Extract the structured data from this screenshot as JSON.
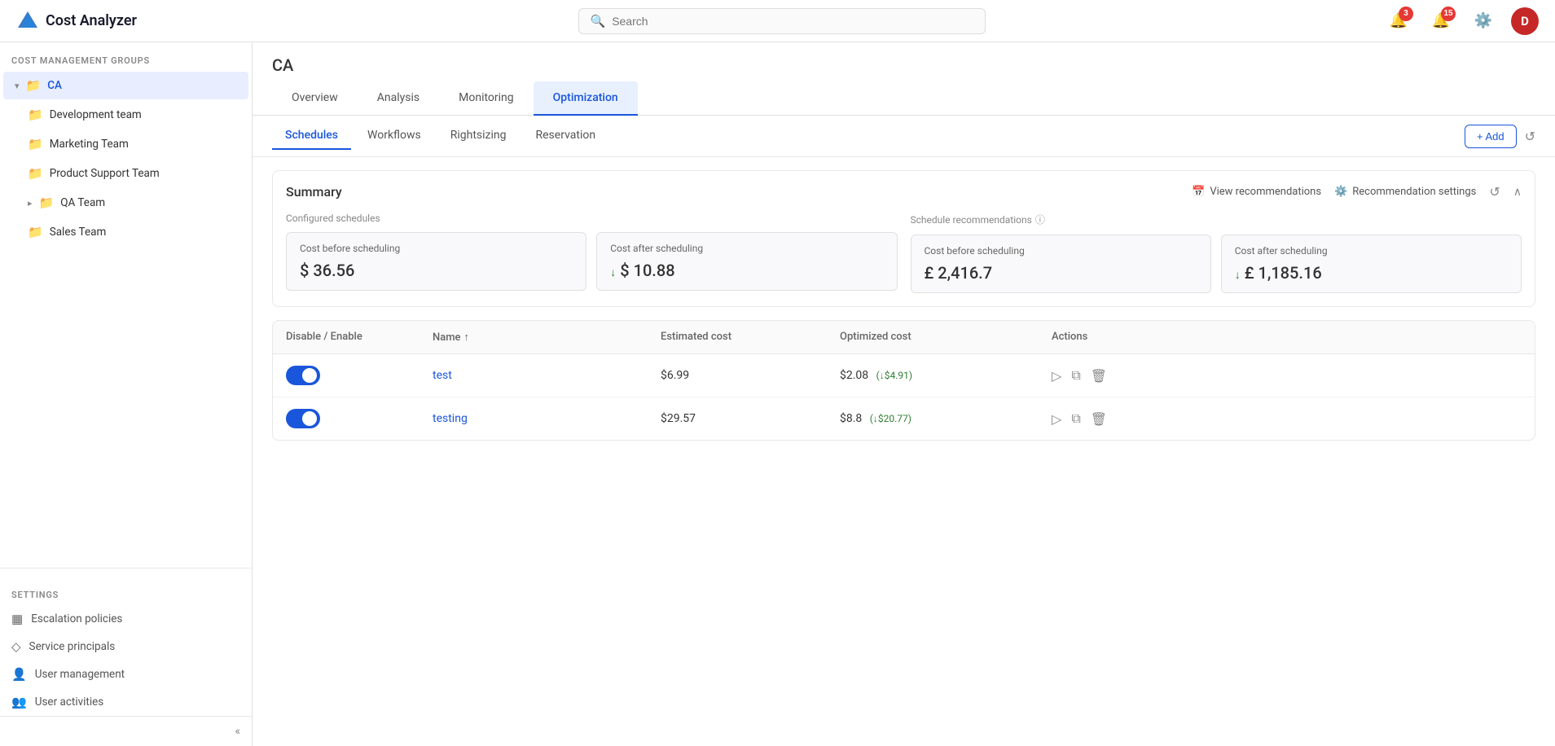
{
  "header": {
    "app_name": "Cost Analyzer",
    "search_placeholder": "Search",
    "notifications_count": "3",
    "alerts_count": "15",
    "avatar_initials": "D"
  },
  "sidebar": {
    "section_label": "COST MANAGEMENT GROUPS",
    "items": [
      {
        "id": "ca",
        "label": "CA",
        "indent": 0,
        "active": true,
        "expanded": true,
        "has_chevron": true
      },
      {
        "id": "dev-team",
        "label": "Development team",
        "indent": 1,
        "active": false
      },
      {
        "id": "marketing-team",
        "label": "Marketing Team",
        "indent": 1,
        "active": false
      },
      {
        "id": "product-support-team",
        "label": "Product Support Team",
        "indent": 1,
        "active": false
      },
      {
        "id": "qa-team",
        "label": "QA Team",
        "indent": 1,
        "active": false,
        "has_chevron": true,
        "collapsed": true
      },
      {
        "id": "sales-team",
        "label": "Sales Team",
        "indent": 1,
        "active": false
      }
    ],
    "settings_label": "SETTINGS",
    "settings_items": [
      {
        "id": "escalation",
        "label": "Escalation policies",
        "icon": "📋"
      },
      {
        "id": "service-principals",
        "label": "Service principals",
        "icon": "◇"
      },
      {
        "id": "user-management",
        "label": "User management",
        "icon": "👤"
      },
      {
        "id": "user-activities",
        "label": "User activities",
        "icon": "👥"
      }
    ],
    "collapse_label": "«"
  },
  "main_tabs": [
    {
      "id": "overview",
      "label": "Overview",
      "active": false
    },
    {
      "id": "analysis",
      "label": "Analysis",
      "active": false
    },
    {
      "id": "monitoring",
      "label": "Monitoring",
      "active": false
    },
    {
      "id": "optimization",
      "label": "Optimization",
      "active": true
    }
  ],
  "sub_tabs": [
    {
      "id": "schedules",
      "label": "Schedules",
      "active": true
    },
    {
      "id": "workflows",
      "label": "Workflows",
      "active": false
    },
    {
      "id": "rightsizing",
      "label": "Rightsizing",
      "active": false
    },
    {
      "id": "reservation",
      "label": "Reservation",
      "active": false
    }
  ],
  "actions": {
    "add_label": "+ Add",
    "refresh_icon": "↺"
  },
  "summary": {
    "title": "Summary",
    "view_recommendations_label": "View recommendations",
    "recommendation_settings_label": "Recommendation settings",
    "configured_schedules_label": "Configured schedules",
    "schedule_recommendations_label": "Schedule recommendations",
    "cost_before_scheduling_label": "Cost before scheduling",
    "cost_after_scheduling_label": "Cost after scheduling",
    "configured_cost_before": "$ 36.56",
    "configured_cost_after": "$ 10.88",
    "recommended_cost_before": "£ 2,416.7",
    "recommended_cost_after": "£ 1,185.16",
    "down_arrow": "↓"
  },
  "table": {
    "columns": [
      "Disable / Enable",
      "Name",
      "Estimated cost",
      "Optimized cost",
      "Actions"
    ],
    "sort_icon": "↑",
    "rows": [
      {
        "enabled": true,
        "name": "test",
        "estimated_cost": "$6.99",
        "optimized_cost": "$2.08",
        "savings": "(↓$4.91)"
      },
      {
        "enabled": true,
        "name": "testing",
        "estimated_cost": "$29.57",
        "optimized_cost": "$8.8",
        "savings": "(↓$20.77)"
      }
    ]
  },
  "page_title": "CA"
}
